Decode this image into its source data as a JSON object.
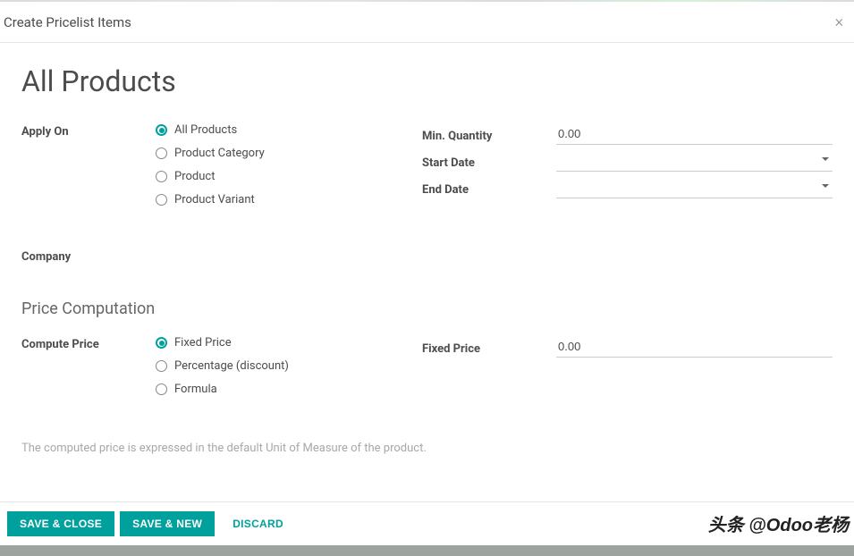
{
  "modal": {
    "title": "Create Pricelist Items"
  },
  "header": {
    "title": "All Products"
  },
  "left": {
    "apply_on": {
      "label": "Apply On",
      "options": [
        "All Products",
        "Product Category",
        "Product",
        "Product Variant"
      ],
      "selected": 0
    },
    "company": {
      "label": "Company"
    }
  },
  "right": {
    "min_qty": {
      "label": "Min. Quantity",
      "value": "0.00"
    },
    "start_date": {
      "label": "Start Date",
      "value": ""
    },
    "end_date": {
      "label": "End Date",
      "value": ""
    }
  },
  "section2": {
    "title": "Price Computation",
    "compute_price": {
      "label": "Compute Price",
      "options": [
        "Fixed Price",
        "Percentage (discount)",
        "Formula"
      ],
      "selected": 0
    },
    "fixed_price": {
      "label": "Fixed Price",
      "value": "0.00"
    }
  },
  "hint": "The computed price is expressed in the default Unit of Measure of the product.",
  "footer": {
    "save_close": "SAVE & CLOSE",
    "save_new": "SAVE & NEW",
    "discard": "DISCARD"
  },
  "watermark": "头条 @Odoo老杨"
}
